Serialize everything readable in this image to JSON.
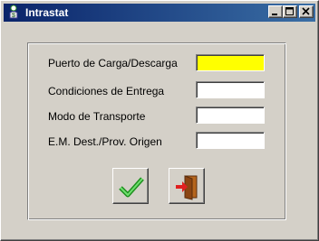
{
  "window": {
    "title": "Intrastat",
    "app_icon": "intrastat-app-icon",
    "controls": [
      "minimize-icon",
      "maximize-icon",
      "close-icon"
    ]
  },
  "form": {
    "fields": [
      {
        "label": "Puerto de Carga/Descarga",
        "value": "",
        "focused": true
      },
      {
        "label": "Condiciones de Entrega",
        "value": ""
      },
      {
        "label": "Modo de Transporte",
        "value": ""
      },
      {
        "label": "E.M. Dest./Prov. Origen",
        "value": ""
      }
    ]
  },
  "buttons": {
    "accept_icon": "checkmark-icon",
    "exit_icon": "exit-door-icon"
  },
  "colors": {
    "titlebar_start": "#0a246a",
    "titlebar_end": "#3a6ea5",
    "focused_field": "#ffff00",
    "window_bg": "#d4d0c8",
    "checkmark": "#2fbf2f"
  }
}
